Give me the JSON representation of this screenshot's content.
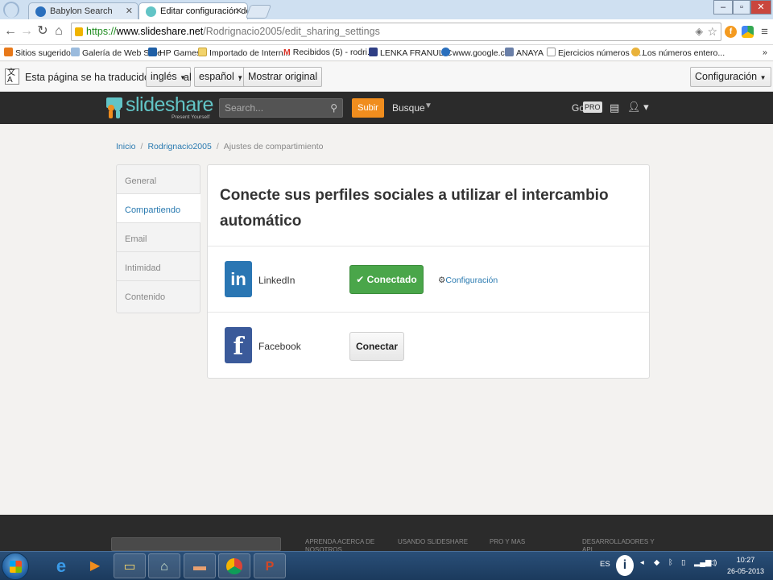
{
  "browser": {
    "tabs": [
      {
        "title": "Babylon Search",
        "active": false
      },
      {
        "title": "Editar configuración de us",
        "active": true
      }
    ],
    "window_controls": {
      "minimize": "–",
      "maximize": "▫",
      "close": "✕"
    },
    "url": {
      "scheme": "https://",
      "host": "www.slideshare.net",
      "path": "/Rodrignacio2005/edit_sharing_settings"
    },
    "bookmarks": [
      "Sitios sugeridos",
      "Galería de Web Slice",
      "HP Games",
      "Importado de Intern...",
      "Recibidos (5) - rodri...",
      "LENKA FRANULIC",
      "www.google.cl",
      "ANAYA",
      "Ejercicios números e...",
      "Los números entero..."
    ],
    "bookmarks_overflow": "»",
    "translate_bar": {
      "prefix": "Esta página se ha traducido del",
      "from_lang": "inglés",
      "connector": "al",
      "to_lang": "español",
      "dot": ".",
      "show_original": "Mostrar original",
      "settings": "Configuración"
    }
  },
  "site": {
    "logo_text": "slideshare",
    "logo_tagline": "Present Yourself",
    "search_placeholder": "Search...",
    "upload_label": "Subir",
    "search_nav_label": "Busque",
    "go_label": "Go",
    "pro_badge": "PRO"
  },
  "breadcrumb": {
    "home": "Inicio",
    "user": "Rodrignacio2005",
    "current": "Ajustes de compartimiento",
    "separator": "/"
  },
  "sidebar": {
    "items": [
      {
        "label": "General",
        "active": false
      },
      {
        "label": "Compartiendo",
        "active": true
      },
      {
        "label": "Email",
        "active": false
      },
      {
        "label": "Intimidad",
        "active": false
      },
      {
        "label": "Contenido",
        "active": false
      }
    ]
  },
  "panel": {
    "title": "Conecte sus perfiles sociales a utilizar el intercambio automático",
    "networks": [
      {
        "name": "LinkedIn",
        "icon": "linkedin-icon",
        "icon_text": "in",
        "color": "#2a76b3",
        "status": "connected",
        "button_label": "✔ Conectado",
        "settings_label": "Configuración"
      },
      {
        "name": "Facebook",
        "icon": "facebook-icon",
        "icon_text": "f",
        "color": "#3b5a9a",
        "status": "disconnected",
        "button_label": "Conectar"
      }
    ]
  },
  "footer": {
    "columns": [
      "APRENDA ACERCA DE NOSOTROS",
      "USANDO SLIDESHARE",
      "PRO Y MAS",
      "DESARROLLADORES Y API"
    ]
  },
  "taskbar": {
    "language": "ES",
    "time": "10:27",
    "date": "26-05-2013"
  }
}
